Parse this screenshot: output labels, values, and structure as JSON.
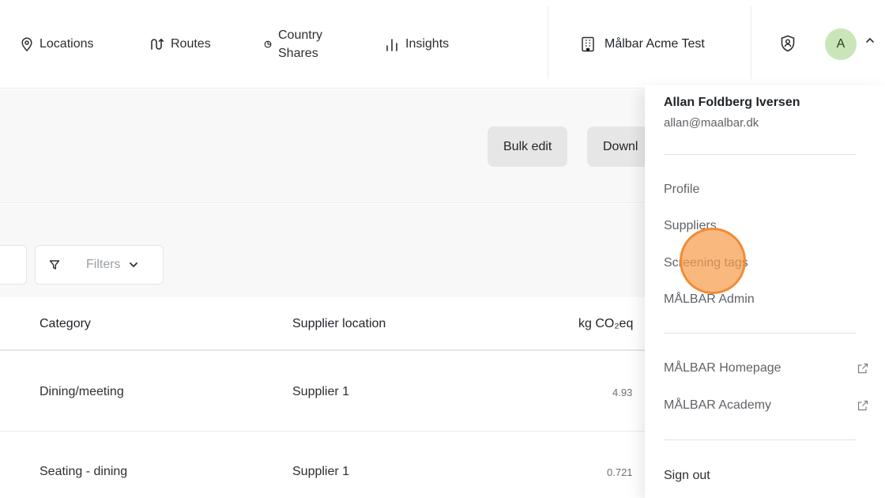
{
  "nav": {
    "items": [
      {
        "label": "Locations",
        "icon": "location-pin-icon"
      },
      {
        "label": "Routes",
        "icon": "route-icon"
      },
      {
        "label_line1": "Country",
        "label_line2": "Shares",
        "icon": "pie-small-icon"
      },
      {
        "label": "Insights",
        "icon": "bar-chart-icon"
      }
    ],
    "org_name": "Målbar Acme Test",
    "avatar_initial": "A"
  },
  "toolbar": {
    "bulk_edit_label": "Bulk edit",
    "download_label": "Downl"
  },
  "filters": {
    "label": "Filters"
  },
  "table": {
    "headers": [
      "Category",
      "Supplier location",
      "kg CO₂eq"
    ],
    "rows": [
      {
        "category": "Dining/meeting",
        "supplier": "Supplier 1",
        "co2": "4.93"
      },
      {
        "category": "Seating - dining",
        "supplier": "Supplier 1",
        "co2": "0.721"
      }
    ]
  },
  "user_menu": {
    "name": "Allan Foldberg Iversen",
    "email": "allan@maalbar.dk",
    "items": [
      "Profile",
      "Suppliers",
      "Screening tags",
      "MÅLBAR Admin"
    ],
    "external_items": [
      "MÅLBAR Homepage",
      "MÅLBAR Academy"
    ],
    "sign_out": "Sign out"
  },
  "colors": {
    "avatar_bg": "#c9e6b8",
    "click_marker": "#f28b35",
    "band_bg": "#f8f8f8"
  }
}
